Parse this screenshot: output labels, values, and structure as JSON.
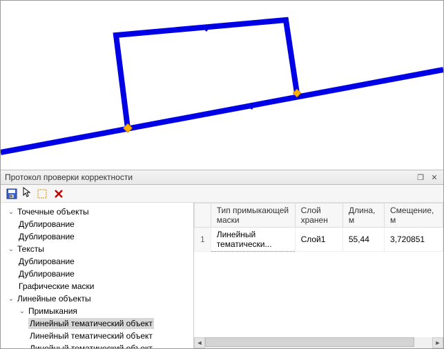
{
  "panel": {
    "title": "Протокол проверки корректности"
  },
  "tree": {
    "n0": "Точечные объекты",
    "n0_0": "Дублирование",
    "n0_1": "Дублирование",
    "n1": "Тексты",
    "n1_0": "Дублирование",
    "n1_1": "Дублирование",
    "n2": "Графические маски",
    "n3": "Линейные объекты",
    "n3_0": "Примыкания",
    "n3_0_0": "Линейный тематический объект",
    "n3_0_1": "Линейный тематический объект",
    "n3_0_2": "Линейный тематический объект"
  },
  "table": {
    "headers": {
      "mask": "Тип примыкающей маски",
      "layer": "Слой хранен",
      "length": "Длина, м",
      "offset": "Смещение, м"
    },
    "rows": [
      {
        "num": "1",
        "mask": "Линейный тематически...",
        "layer": "Слой1",
        "length": "55,44",
        "offset": "3,720851"
      }
    ]
  }
}
